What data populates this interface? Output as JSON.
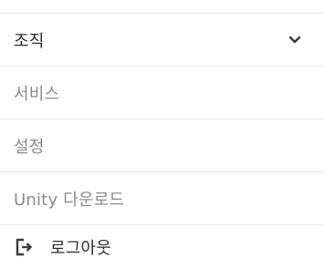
{
  "menu": {
    "items": [
      {
        "label": "조직",
        "icon": "chevron-down-icon"
      },
      {
        "label": "서비스"
      },
      {
        "label": "설정"
      },
      {
        "label": "Unity 다운로드"
      },
      {
        "label": "로그아웃",
        "icon": "logout-icon"
      }
    ]
  },
  "colors": {
    "text_primary": "#2b2b2b",
    "text_muted": "#8a8a8a",
    "divider": "#e5e5e5",
    "icon": "#3a3a3a"
  }
}
